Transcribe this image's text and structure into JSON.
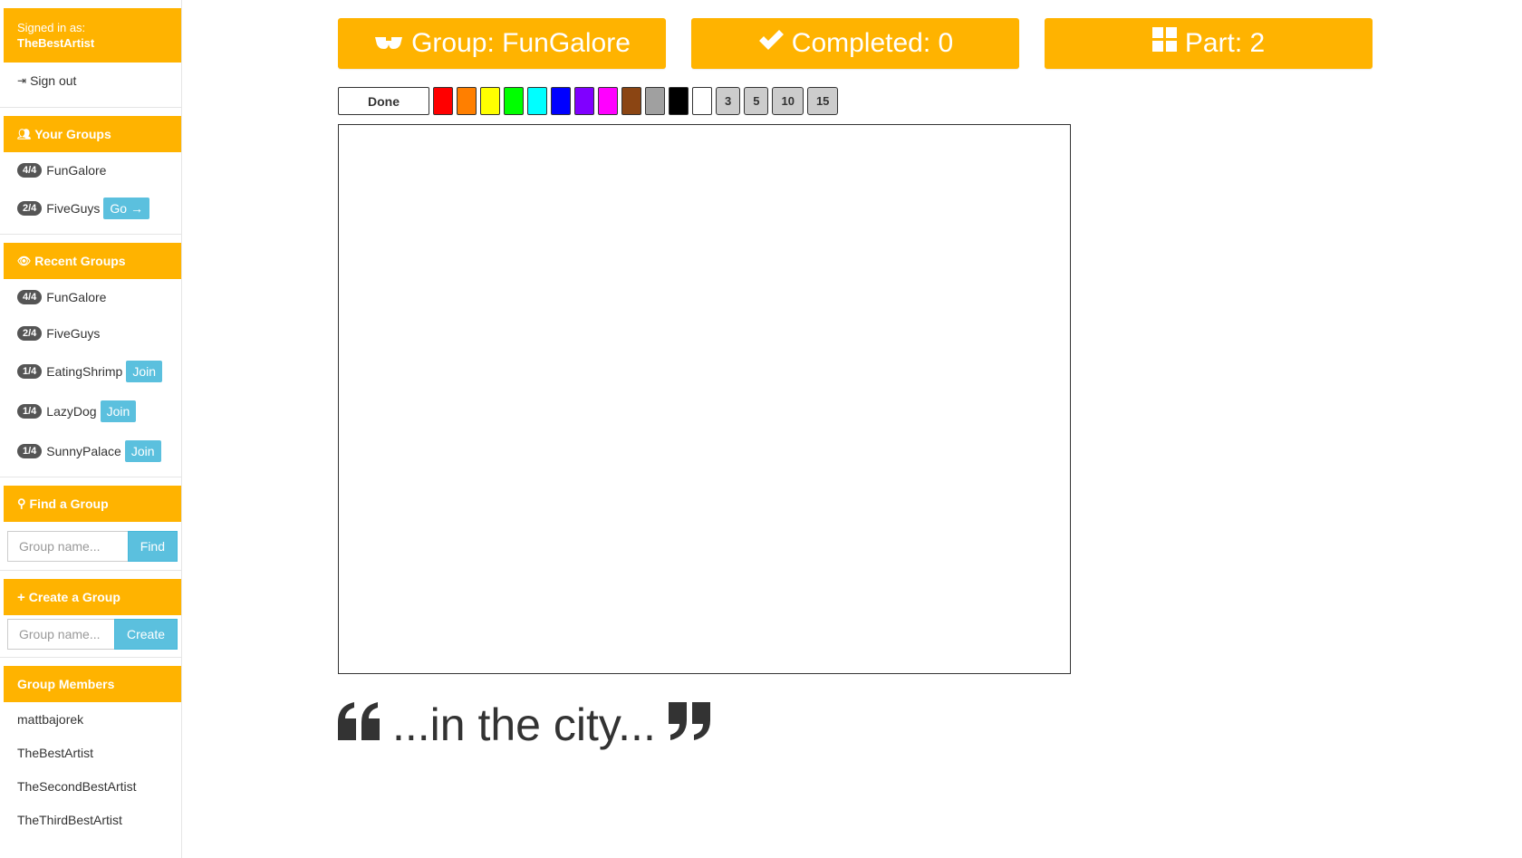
{
  "sidebar": {
    "signed_in_label": "Signed in as:",
    "username": "TheBestArtist",
    "sign_out": "Sign out",
    "your_groups": {
      "title": "Your Groups",
      "items": [
        {
          "badge": "4/4",
          "name": "FunGalore",
          "action": ""
        },
        {
          "badge": "2/4",
          "name": "FiveGuys",
          "action": "Go"
        }
      ]
    },
    "recent_groups": {
      "title": "Recent Groups",
      "items": [
        {
          "badge": "4/4",
          "name": "FunGalore",
          "action": ""
        },
        {
          "badge": "2/4",
          "name": "FiveGuys",
          "action": ""
        },
        {
          "badge": "1/4",
          "name": "EatingShrimp",
          "action": "Join"
        },
        {
          "badge": "1/4",
          "name": "LazyDog",
          "action": "Join"
        },
        {
          "badge": "1/4",
          "name": "SunnyPalace",
          "action": "Join"
        }
      ]
    },
    "find_group": {
      "title": "Find a Group",
      "placeholder": "Group name...",
      "button": "Find"
    },
    "create_group": {
      "title": "Create a Group",
      "placeholder": "Group name...",
      "button": "Create"
    },
    "members": {
      "title": "Group Members",
      "items": [
        "mattbajorek",
        "TheBestArtist",
        "TheSecondBestArtist",
        "TheThirdBestArtist"
      ]
    }
  },
  "header": {
    "group": "Group: FunGalore",
    "completed": "Completed: 0",
    "part": "Part: 2"
  },
  "toolbar": {
    "done": "Done",
    "colors": [
      "#ff0000",
      "#ff7f00",
      "#ffff00",
      "#00ff00",
      "#00ffff",
      "#0000ff",
      "#8000ff",
      "#ff00ff",
      "#8b4513",
      "#a0a0a0",
      "#000000",
      "#ffffff"
    ],
    "sizes": [
      "3",
      "5",
      "10",
      "15"
    ]
  },
  "prompt": {
    "text": "...in the city..."
  },
  "theme": {
    "accent": "#ffb300",
    "info": "#5bc0de",
    "badge": "#555555"
  }
}
